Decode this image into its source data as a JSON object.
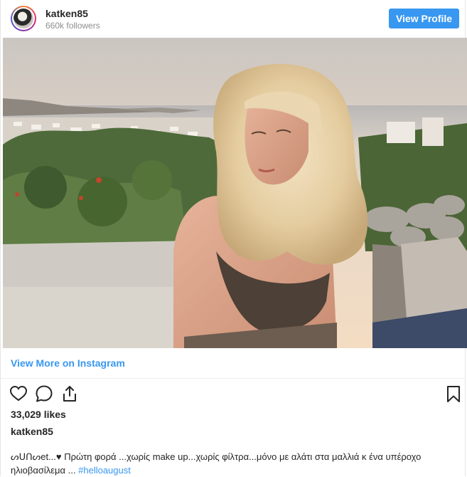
{
  "header": {
    "username": "katken85",
    "followers": "660k followers",
    "view_profile_label": "View Profile"
  },
  "post": {
    "image_alt": "Woman with wavy blonde hair seated on a terrace at sunset overlooking the sea",
    "view_more_label": "View More on Instagram",
    "likes": "33,029 likes",
    "caption_username": "katken85",
    "caption_text": "ᔕᑌᑎᔕet...♥ Πρώτη φορά ...χωρίς make up...χωρίς φίλτρα...μόνο με αλάτι στα μαλλιά κ ένα υπέροχο ηλιοβασίλεμα ... ",
    "hashtag": "#helloaugust"
  },
  "icons": {
    "like": "heart-icon",
    "comment": "comment-icon",
    "share": "share-icon",
    "save": "bookmark-icon"
  },
  "colors": {
    "accent": "#3897f0",
    "text": "#262626",
    "muted": "#8e8e8e"
  }
}
